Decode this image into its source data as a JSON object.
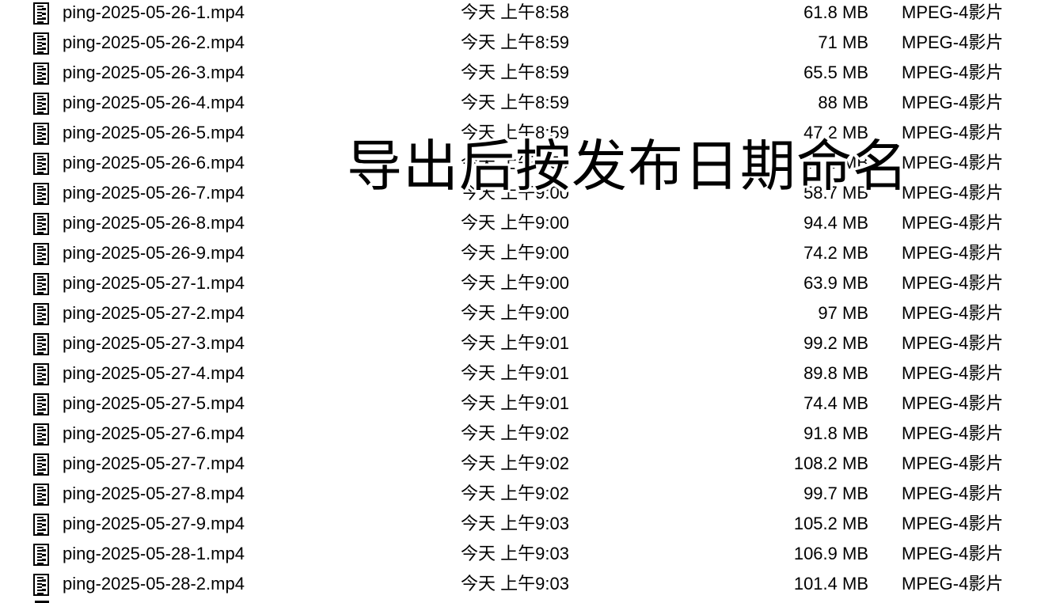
{
  "files": [
    {
      "name": "ping-2025-05-26-1.mp4",
      "date": "今天 上午8:58",
      "size": "61.8 MB",
      "kind": "MPEG-4影片"
    },
    {
      "name": "ping-2025-05-26-2.mp4",
      "date": "今天 上午8:59",
      "size": "71 MB",
      "kind": "MPEG-4影片"
    },
    {
      "name": "ping-2025-05-26-3.mp4",
      "date": "今天 上午8:59",
      "size": "65.5 MB",
      "kind": "MPEG-4影片"
    },
    {
      "name": "ping-2025-05-26-4.mp4",
      "date": "今天 上午8:59",
      "size": "88 MB",
      "kind": "MPEG-4影片"
    },
    {
      "name": "ping-2025-05-26-5.mp4",
      "date": "今天 上午8:59",
      "size": "47.2 MB",
      "kind": "MPEG-4影片"
    },
    {
      "name": "ping-2025-05-26-6.mp4",
      "date": "今天 上午8:59",
      "size": "46.6 MB",
      "kind": "MPEG-4影片"
    },
    {
      "name": "ping-2025-05-26-7.mp4",
      "date": "今天 上午9:00",
      "size": "58.7 MB",
      "kind": "MPEG-4影片"
    },
    {
      "name": "ping-2025-05-26-8.mp4",
      "date": "今天 上午9:00",
      "size": "94.4 MB",
      "kind": "MPEG-4影片"
    },
    {
      "name": "ping-2025-05-26-9.mp4",
      "date": "今天 上午9:00",
      "size": "74.2 MB",
      "kind": "MPEG-4影片"
    },
    {
      "name": "ping-2025-05-27-1.mp4",
      "date": "今天 上午9:00",
      "size": "63.9 MB",
      "kind": "MPEG-4影片"
    },
    {
      "name": "ping-2025-05-27-2.mp4",
      "date": "今天 上午9:00",
      "size": "97 MB",
      "kind": "MPEG-4影片"
    },
    {
      "name": "ping-2025-05-27-3.mp4",
      "date": "今天 上午9:01",
      "size": "99.2 MB",
      "kind": "MPEG-4影片"
    },
    {
      "name": "ping-2025-05-27-4.mp4",
      "date": "今天 上午9:01",
      "size": "89.8 MB",
      "kind": "MPEG-4影片"
    },
    {
      "name": "ping-2025-05-27-5.mp4",
      "date": "今天 上午9:01",
      "size": "74.4 MB",
      "kind": "MPEG-4影片"
    },
    {
      "name": "ping-2025-05-27-6.mp4",
      "date": "今天 上午9:02",
      "size": "91.8 MB",
      "kind": "MPEG-4影片"
    },
    {
      "name": "ping-2025-05-27-7.mp4",
      "date": "今天 上午9:02",
      "size": "108.2 MB",
      "kind": "MPEG-4影片"
    },
    {
      "name": "ping-2025-05-27-8.mp4",
      "date": "今天 上午9:02",
      "size": "99.7 MB",
      "kind": "MPEG-4影片"
    },
    {
      "name": "ping-2025-05-27-9.mp4",
      "date": "今天 上午9:03",
      "size": "105.2 MB",
      "kind": "MPEG-4影片"
    },
    {
      "name": "ping-2025-05-28-1.mp4",
      "date": "今天 上午9:03",
      "size": "106.9 MB",
      "kind": "MPEG-4影片"
    },
    {
      "name": "ping-2025-05-28-2.mp4",
      "date": "今天 上午9:03",
      "size": "101.4 MB",
      "kind": "MPEG-4影片"
    }
  ],
  "file_icon": "video-file-thumbnail-icon",
  "overlay": {
    "caption": "导出后按发布日期命名"
  }
}
